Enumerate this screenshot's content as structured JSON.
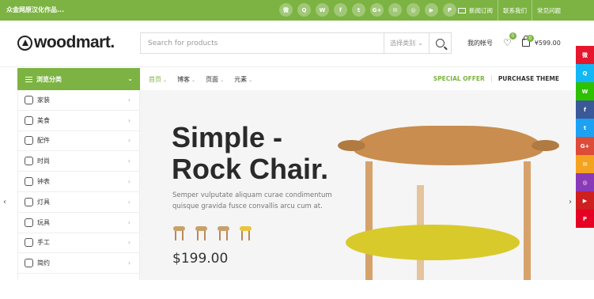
{
  "topbar": {
    "tagline": "众金网原汉化作品...",
    "socials": [
      {
        "icon": "weibo-icon",
        "glyph": "微"
      },
      {
        "icon": "qq-icon",
        "glyph": "Q"
      },
      {
        "icon": "wechat-icon",
        "glyph": "W"
      },
      {
        "icon": "facebook-icon",
        "glyph": "f"
      },
      {
        "icon": "twitter-icon",
        "glyph": "t"
      },
      {
        "icon": "google-plus-icon",
        "glyph": "G+"
      },
      {
        "icon": "email-icon",
        "glyph": "✉"
      },
      {
        "icon": "instagram-icon",
        "glyph": "◎"
      },
      {
        "icon": "youtube-icon",
        "glyph": "▶"
      },
      {
        "icon": "pinterest-icon",
        "glyph": "P"
      }
    ],
    "links": [
      "新闻订阅",
      "联系我们",
      "常见问题"
    ]
  },
  "header": {
    "logo": "woodmart.",
    "search_placeholder": "Search for products",
    "category_select": "选择类别",
    "account": "我的帐号",
    "wishlist_count": "0",
    "cart_count": "0",
    "cart_total": "¥599.00"
  },
  "catbar": {
    "label": "浏览分类"
  },
  "nav": {
    "items": [
      "首页",
      "博客",
      "页面",
      "元素"
    ],
    "offer": "SPECIAL OFFER",
    "theme": "PURCHASE THEME"
  },
  "sidebar": {
    "items": [
      "家装",
      "美食",
      "配件",
      "时尚",
      "钟表",
      "灯具",
      "玩具",
      "手工",
      "简约"
    ]
  },
  "hero": {
    "title_line1": "Simple -",
    "title_line2": "Rock Chair.",
    "description": "Semper vulputate aliquam curae condimentum quisque gravida fusce convallis arcu cum at.",
    "price": "$199.00"
  },
  "side_share": {
    "colors": [
      "#e6162d",
      "#12b7f5",
      "#2dc100",
      "#3b5998",
      "#1da1f2",
      "#dd4b39",
      "#f4a320",
      "#8a3ab9",
      "#cd201f",
      "#e60023"
    ],
    "icons": [
      "weibo-icon",
      "qq-icon",
      "wechat-icon",
      "facebook-icon",
      "twitter-icon",
      "google-plus-icon",
      "email-icon",
      "instagram-icon",
      "youtube-icon",
      "pinterest-icon"
    ],
    "glyphs": [
      "微",
      "Q",
      "W",
      "f",
      "t",
      "G+",
      "✉",
      "◎",
      "▶",
      "P"
    ]
  },
  "colors": {
    "accent": "#7cb342"
  }
}
